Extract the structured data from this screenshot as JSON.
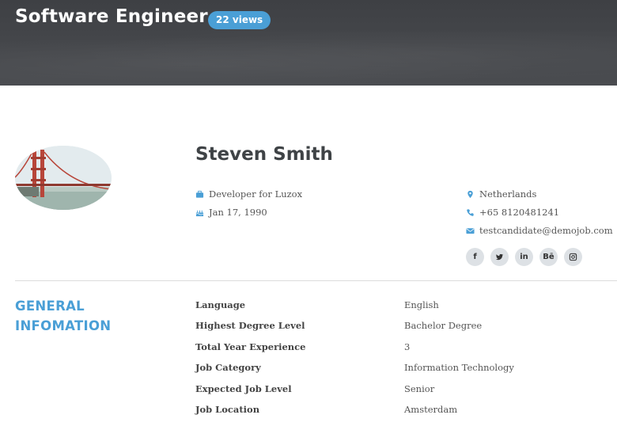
{
  "header": {
    "title": "Software Engineer",
    "views_badge": "22 views"
  },
  "profile": {
    "name": "Steven Smith",
    "position": "Developer for Luzox",
    "birth_date": "Jan 17, 1990",
    "location": "Netherlands",
    "phone": "+65 8120481241",
    "email": "testcandidate@demojob.com",
    "socials": [
      {
        "name": "facebook",
        "glyph": "f"
      },
      {
        "name": "twitter",
        "glyph": ""
      },
      {
        "name": "linkedin",
        "glyph": "in"
      },
      {
        "name": "behance",
        "glyph": "Bē"
      },
      {
        "name": "instagram",
        "glyph": ""
      }
    ]
  },
  "general": {
    "title_line1": "GENERAL",
    "title_line2": "INFOMATION",
    "rows": [
      {
        "label": "Language",
        "value": "English"
      },
      {
        "label": "Highest Degree Level",
        "value": "Bachelor Degree"
      },
      {
        "label": "Total Year Experience",
        "value": "3"
      },
      {
        "label": "Job Category",
        "value": "Information Technology"
      },
      {
        "label": "Expected Job Level",
        "value": "Senior"
      },
      {
        "label": "Job Location",
        "value": "Amsterdam"
      }
    ]
  },
  "colors": {
    "accent": "#4a9fd6",
    "hero_bg": "#43454a",
    "text": "#555555"
  },
  "icons": {
    "position": "briefcase-icon",
    "birth_date": "cake-icon",
    "location": "map-marker-icon",
    "phone": "phone-icon",
    "email": "envelope-icon"
  }
}
